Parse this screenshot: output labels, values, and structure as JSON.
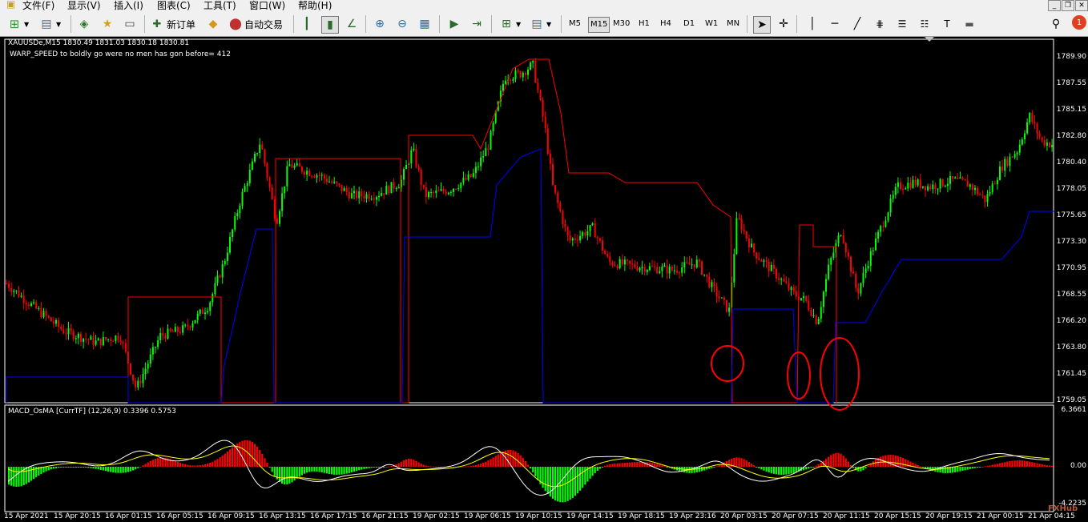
{
  "menu": {
    "items": [
      {
        "label": "文件(F)"
      },
      {
        "label": "显示(V)"
      },
      {
        "label": "插入(I)"
      },
      {
        "label": "图表(C)"
      },
      {
        "label": "工具(T)"
      },
      {
        "label": "窗口(W)"
      },
      {
        "label": "帮助(H)"
      }
    ],
    "window_controls": [
      "_",
      "❐",
      "✕"
    ]
  },
  "toolbar": {
    "new_order_label": "新订单",
    "auto_trade_label": "自动交易",
    "timeframes": [
      "M5",
      "M15",
      "M30",
      "H1",
      "H4",
      "D1",
      "W1",
      "MN"
    ],
    "active_timeframe": "M15",
    "notification_count": "1"
  },
  "chart": {
    "symbol_info": "XAUUSDe,M15  1830.49 1831.03 1830.18 1830.81",
    "indicator_text": "WARP_SPEED to boldly go were no men has gon before= 412",
    "price_labels": [
      "1789.90",
      "1787.55",
      "1785.15",
      "1782.80",
      "1780.40",
      "1778.05",
      "1775.65",
      "1773.30",
      "1770.95",
      "1768.55",
      "1766.20",
      "1763.80",
      "1761.45",
      "1759.05"
    ],
    "time_labels": [
      "15 Apr 2021",
      "15 Apr 20:15",
      "16 Apr 01:15",
      "16 Apr 05:15",
      "16 Apr 09:15",
      "16 Apr 13:15",
      "16 Apr 17:15",
      "16 Apr 21:15",
      "19 Apr 02:15",
      "19 Apr 06:15",
      "19 Apr 10:15",
      "19 Apr 14:15",
      "19 Apr 18:15",
      "19 Apr 23:16",
      "20 Apr 03:15",
      "20 Apr 07:15",
      "20 Apr 11:15",
      "20 Apr 15:15",
      "20 Apr 19:15",
      "21 Apr 00:15",
      "21 Apr 04:15"
    ],
    "colors": {
      "bull": "#00ff00",
      "bear": "#ff0000",
      "background": "#000000",
      "upper_line": "#ff0000",
      "lower_line": "#0000ff",
      "macd_main": "#ffffff",
      "macd_signal": "#ffff00",
      "annotation": "#ff0000"
    }
  },
  "macd": {
    "title": "MACD_OsMA [CurrTF] (12,26,9) 0.3396 0.5753",
    "scale_labels": [
      "6.3661",
      "0.00",
      "-4.2235"
    ]
  },
  "watermark": "FXHub"
}
